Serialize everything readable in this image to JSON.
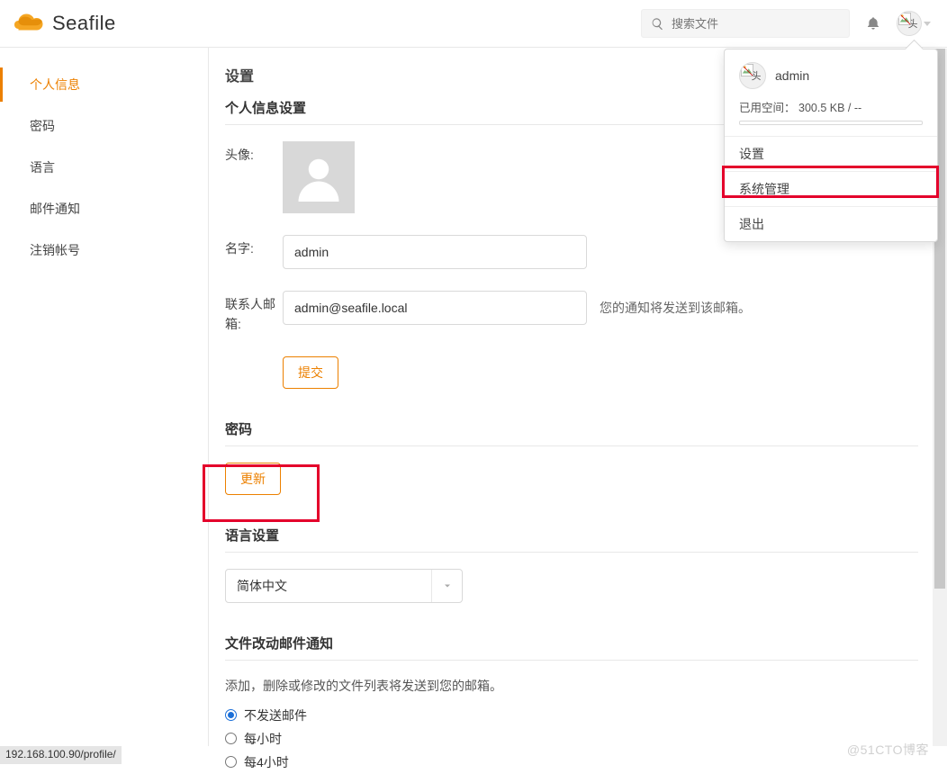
{
  "brand": {
    "name": "Seafile"
  },
  "header": {
    "search_placeholder": "搜索文件",
    "avatar_alt": "头"
  },
  "dropdown": {
    "username": "admin",
    "storage_label": "已用空间：",
    "storage_value": "300.5 KB / --",
    "items": [
      "设置",
      "系统管理",
      "退出"
    ]
  },
  "sidebar": {
    "items": [
      "个人信息",
      "密码",
      "语言",
      "邮件通知",
      "注销帐号"
    ],
    "active_index": 0
  },
  "main": {
    "page_title": "设置",
    "profile": {
      "section_title": "个人信息设置",
      "avatar_label": "头像:",
      "name_label": "名字:",
      "name_value": "admin",
      "email_label": "联系人邮箱:",
      "email_value": "admin@seafile.local",
      "email_hint": "您的通知将发送到该邮箱。",
      "submit_label": "提交"
    },
    "password": {
      "section_title": "密码",
      "update_label": "更新"
    },
    "language": {
      "section_title": "语言设置",
      "selected": "简体中文"
    },
    "notify": {
      "section_title": "文件改动邮件通知",
      "desc": "添加，删除或修改的文件列表将发送到您的邮箱。",
      "options": [
        "不发送邮件",
        "每小时",
        "每4小时"
      ],
      "selected_index": 0
    }
  },
  "status_url": "192.168.100.90/profile/",
  "watermark": "@51CTO博客"
}
